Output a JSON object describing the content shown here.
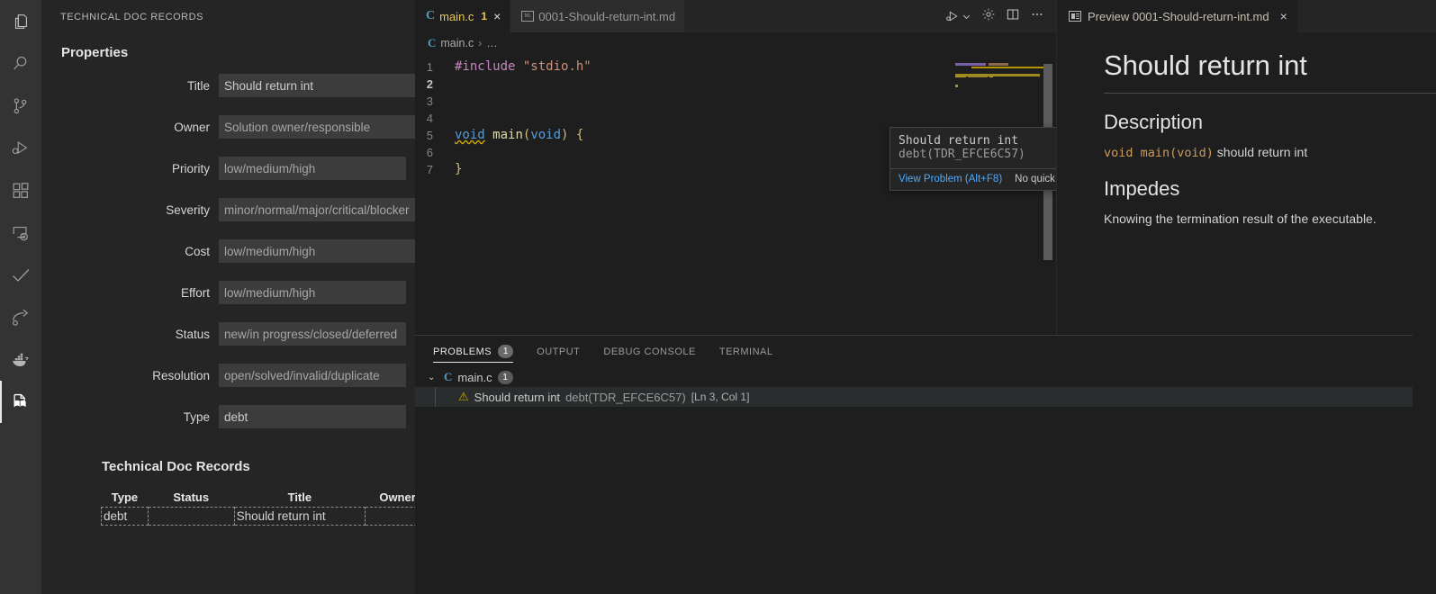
{
  "activity_bar": {
    "items": [
      {
        "name": "explorer",
        "icon": "files-icon",
        "active": false
      },
      {
        "name": "search",
        "icon": "search-icon",
        "active": false
      },
      {
        "name": "source-control",
        "icon": "source-control-icon",
        "active": false
      },
      {
        "name": "run-and-debug",
        "icon": "run-debug-icon",
        "active": false
      },
      {
        "name": "extensions",
        "icon": "extensions-icon",
        "active": false
      },
      {
        "name": "remote-explorer",
        "icon": "remote-explorer-icon",
        "active": false
      },
      {
        "name": "todo-tree",
        "icon": "check-icon",
        "active": false
      },
      {
        "name": "live-share",
        "icon": "share-icon",
        "active": false
      },
      {
        "name": "docker",
        "icon": "docker-icon",
        "active": false
      },
      {
        "name": "technical-doc-records",
        "icon": "book-page-icon",
        "active": true
      }
    ]
  },
  "sidebar": {
    "title": "TECHNICAL DOC RECORDS",
    "properties_heading": "Properties",
    "fields": [
      {
        "label": "Title",
        "value": "Should return int",
        "placeholder": ""
      },
      {
        "label": "Owner",
        "value": "",
        "placeholder": "Solution owner/responsible"
      },
      {
        "label": "Priority",
        "value": "",
        "placeholder": "low/medium/high"
      },
      {
        "label": "Severity",
        "value": "",
        "placeholder": "minor/normal/major/critical/blocker"
      },
      {
        "label": "Cost",
        "value": "",
        "placeholder": "low/medium/high"
      },
      {
        "label": "Effort",
        "value": "",
        "placeholder": "low/medium/high"
      },
      {
        "label": "Status",
        "value": "",
        "placeholder": "new/in progress/closed/deferred"
      },
      {
        "label": "Resolution",
        "value": "",
        "placeholder": "open/solved/invalid/duplicate"
      },
      {
        "label": "Type",
        "value": "debt",
        "placeholder": ""
      }
    ],
    "records_heading": "Technical Doc Records",
    "table": {
      "columns": [
        "Type",
        "Status",
        "Title",
        "Owner"
      ],
      "rows": [
        {
          "type": "debt",
          "status": "",
          "title": "Should return int",
          "owner": ""
        }
      ]
    }
  },
  "editor": {
    "tabs": [
      {
        "label": "main.c",
        "icon": "c-file-icon",
        "badge": "1",
        "close": "×",
        "active": true
      },
      {
        "label": "0001-Should-return-int.md",
        "icon": "markdown-file-icon",
        "badge": "",
        "close": "",
        "active": false
      }
    ],
    "actions": [
      {
        "name": "run-and-debug-button",
        "icon": "run-debug-icon"
      },
      {
        "name": "run-options-dropdown",
        "icon": "chevron-down-icon"
      },
      {
        "name": "settings-button",
        "icon": "gear-icon"
      },
      {
        "name": "split-editor-button",
        "icon": "split-editor-icon"
      },
      {
        "name": "more-actions-button",
        "icon": "ellipsis-icon"
      }
    ],
    "breadcrumb": {
      "file": "main.c",
      "separator": "›",
      "tail": "…"
    },
    "code": [
      {
        "n": "1",
        "current": false,
        "tokens": [
          {
            "t": "#include",
            "c": "kw-pink"
          },
          {
            "t": " ",
            "c": ""
          },
          {
            "t": "\"stdio.h\"",
            "c": "str"
          }
        ]
      },
      {
        "n": "2",
        "current": true,
        "tokens": []
      },
      {
        "n": "3",
        "current": false,
        "tokens": []
      },
      {
        "n": "4",
        "current": false,
        "tokens": []
      },
      {
        "n": "5",
        "current": false,
        "tokens": [
          {
            "t": "void",
            "c": "kw-blue squiggle"
          },
          {
            "t": " ",
            "c": ""
          },
          {
            "t": "main",
            "c": "fn"
          },
          {
            "t": "(",
            "c": "punc-y"
          },
          {
            "t": "void",
            "c": "kw-blue"
          },
          {
            "t": ")",
            "c": "punc-y"
          },
          {
            "t": " ",
            "c": ""
          },
          {
            "t": "{",
            "c": "punc-y"
          }
        ]
      },
      {
        "n": "6",
        "current": false,
        "tokens": []
      },
      {
        "n": "7",
        "current": false,
        "tokens": [
          {
            "t": "}",
            "c": "punc-y"
          }
        ]
      }
    ],
    "hover": {
      "message": "Should return int",
      "source": "debt(TDR_EFCE6C57)",
      "view_problem": "View Problem (Alt+F8)",
      "no_quick_fixes": "No quick fixes available"
    }
  },
  "preview": {
    "tab_label": "Preview 0001-Should-return-int.md",
    "tab_close": "×",
    "title": "Should return int",
    "sections": [
      {
        "heading": "Description",
        "code": "void main(void)",
        "text": " should return int"
      },
      {
        "heading": "Impedes",
        "code": "",
        "text": "Knowing the termination result of the executable."
      }
    ]
  },
  "panel": {
    "tabs": [
      {
        "label": "PROBLEMS",
        "badge": "1",
        "active": true
      },
      {
        "label": "OUTPUT",
        "badge": "",
        "active": false
      },
      {
        "label": "DEBUG CONSOLE",
        "badge": "",
        "active": false
      },
      {
        "label": "TERMINAL",
        "badge": "",
        "active": false
      }
    ],
    "file_group": {
      "chevron": "⌄",
      "icon_letter": "C",
      "name": "main.c",
      "count": "1"
    },
    "problems": [
      {
        "icon": "warning-icon",
        "message": "Should return int",
        "source": "debt(TDR_EFCE6C57)",
        "location": "[Ln 3, Col 1]"
      }
    ]
  },
  "colors": {
    "accent": "#4daafc",
    "warning": "#cca700",
    "active_tab_text": "#e7c855",
    "c_icon": "#519aba"
  }
}
